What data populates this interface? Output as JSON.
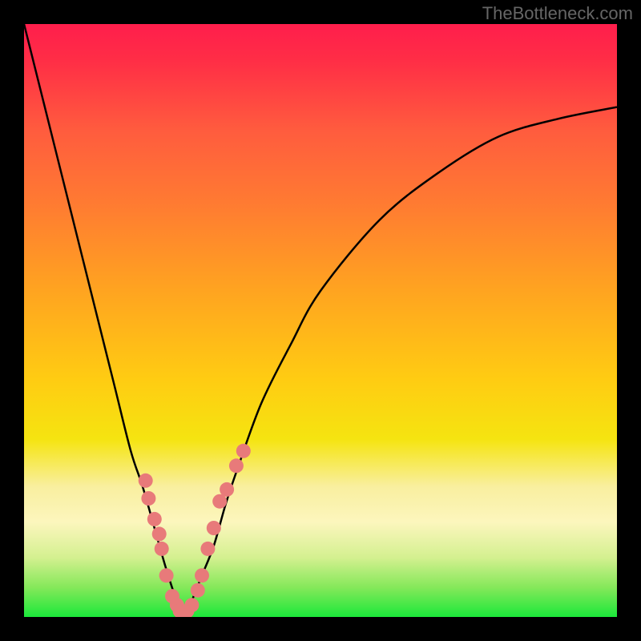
{
  "watermark": "TheBottleneck.com",
  "chart_data": {
    "type": "line",
    "title": "",
    "xlabel": "",
    "ylabel": "",
    "description": "V-shaped bottleneck curve where y-axis represents bottleneck percentage (mapped to color: red=high, green=low) and the black curve descends from top-left to a minimum near x≈0.27 then rises to the right",
    "curve": {
      "x": [
        0.0,
        0.05,
        0.1,
        0.15,
        0.18,
        0.2,
        0.22,
        0.24,
        0.26,
        0.27,
        0.28,
        0.3,
        0.32,
        0.34,
        0.36,
        0.4,
        0.45,
        0.5,
        0.6,
        0.7,
        0.8,
        0.9,
        1.0
      ],
      "y": [
        1.0,
        0.8,
        0.6,
        0.4,
        0.28,
        0.22,
        0.15,
        0.08,
        0.02,
        0.0,
        0.02,
        0.07,
        0.12,
        0.19,
        0.25,
        0.36,
        0.46,
        0.55,
        0.67,
        0.75,
        0.81,
        0.84,
        0.86
      ],
      "note": "x and y normalized 0-1 over the plot area; y=0 is bottom (green), y=1 is top (red)"
    },
    "scatter_points": {
      "x": [
        0.205,
        0.21,
        0.22,
        0.228,
        0.232,
        0.24,
        0.25,
        0.258,
        0.263,
        0.27,
        0.275,
        0.283,
        0.293,
        0.3,
        0.31,
        0.32,
        0.33,
        0.342,
        0.358,
        0.37
      ],
      "y": [
        0.23,
        0.2,
        0.165,
        0.14,
        0.115,
        0.07,
        0.035,
        0.02,
        0.01,
        0.005,
        0.01,
        0.02,
        0.045,
        0.07,
        0.115,
        0.15,
        0.195,
        0.215,
        0.255,
        0.28
      ],
      "note": "pink/salmon dots clustered along the curve near its minimum"
    },
    "gradient_stops": [
      {
        "pos": 0.0,
        "color": "#ff1e4c"
      },
      {
        "pos": 0.18,
        "color": "#ff5c3e"
      },
      {
        "pos": 0.45,
        "color": "#ffa420"
      },
      {
        "pos": 0.7,
        "color": "#f5e410"
      },
      {
        "pos": 0.84,
        "color": "#fcf6bd"
      },
      {
        "pos": 0.95,
        "color": "#85e85a"
      },
      {
        "pos": 1.0,
        "color": "#1be83a"
      }
    ],
    "xlim": [
      0,
      1
    ],
    "ylim": [
      0,
      1
    ]
  }
}
